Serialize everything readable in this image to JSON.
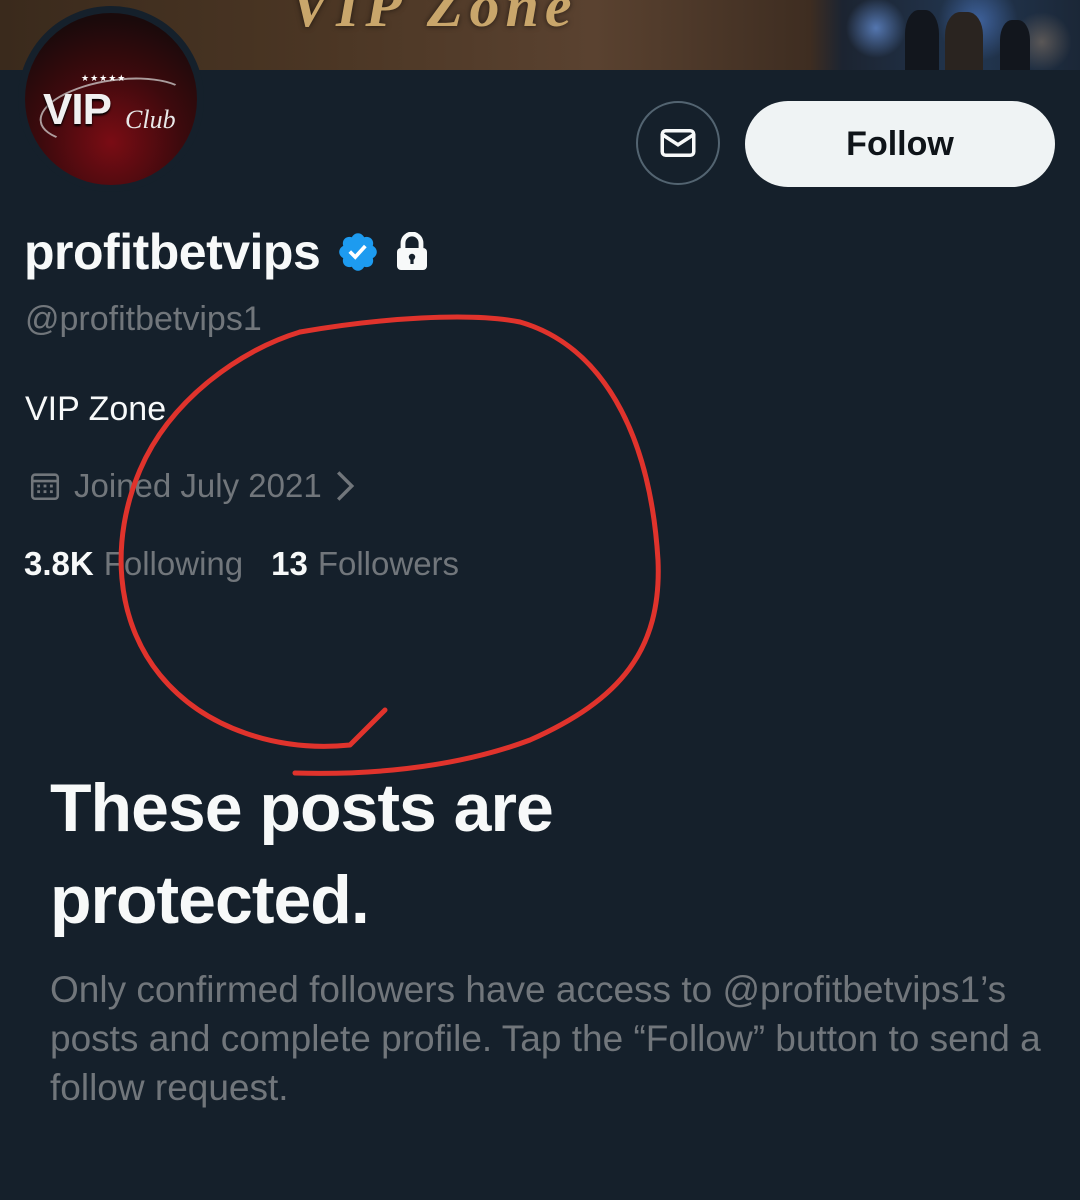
{
  "banner": {
    "text": "VIP Zone"
  },
  "avatar": {
    "stars": "★★★★★",
    "logo_main": "VIP",
    "logo_sub": "Club"
  },
  "actions": {
    "message_icon": "envelope-icon",
    "follow_label": "Follow"
  },
  "profile": {
    "display_name": "profitbetvips",
    "verified_icon": "verified-badge-icon",
    "protected_icon": "lock-icon",
    "handle": "@profitbetvips1",
    "bio": "VIP Zone",
    "joined": "Joined July 2021",
    "following_count": "3.8K",
    "following_label": "Following",
    "followers_count": "13",
    "followers_label": "Followers"
  },
  "protected": {
    "title": "These posts are protected.",
    "body": "Only confirmed followers have access to @profitbetvips1’s posts and complete profile. Tap the “Follow” button to send a follow request."
  },
  "colors": {
    "background": "#15202b",
    "primary_text": "#f7f9f9",
    "secondary_text": "#71767b",
    "verified_blue": "#1d9bf0",
    "annotation_red": "#e0332c",
    "follow_button_bg": "#eff3f4"
  }
}
